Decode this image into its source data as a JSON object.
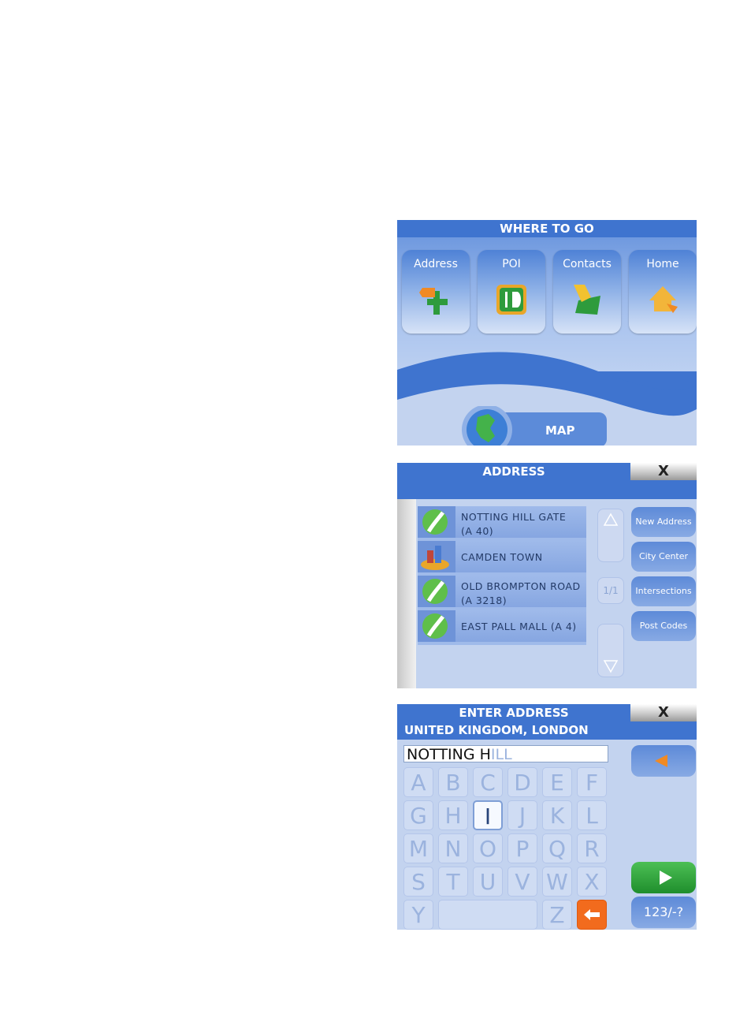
{
  "screen1": {
    "title": "WHERE TO GO",
    "tiles": [
      {
        "label": "Address"
      },
      {
        "label": "POI"
      },
      {
        "label": "Contacts"
      },
      {
        "label": "Home"
      }
    ],
    "map_label": "MAP"
  },
  "screen2": {
    "title": "ADDRESS",
    "close": "X",
    "rows": [
      {
        "line1": "NOTTING HILL GATE",
        "line2": "(A 40)"
      },
      {
        "line1": "CAMDEN TOWN",
        "line2": ""
      },
      {
        "line1": "OLD BROMPTON ROAD",
        "line2": "(A 3218)"
      },
      {
        "line1": "EAST PALL MALL (A 4)",
        "line2": ""
      }
    ],
    "page_indicator": "1/1",
    "side_buttons": [
      "New Address",
      "City Center",
      "Intersections",
      "Post Codes"
    ]
  },
  "screen3": {
    "title": "ENTER ADDRESS",
    "close": "X",
    "subtitle": "UNITED KINGDOM, LONDON",
    "typed_text": "NOTTING H",
    "suggest_text": "ILL",
    "keys_row1": [
      "A",
      "B",
      "C",
      "D",
      "E",
      "F"
    ],
    "keys_row2": [
      "G",
      "H",
      "I",
      "J",
      "K",
      "L"
    ],
    "keys_row3": [
      "M",
      "N",
      "O",
      "P",
      "Q",
      "R"
    ],
    "keys_row4": [
      "S",
      "T",
      "U",
      "V",
      "W",
      "X"
    ],
    "keys_row5": [
      "Y",
      "Z"
    ],
    "mode_button": "123/-?",
    "colors": {
      "accent": "#3f74cf",
      "go": "#2fa33a",
      "backspace": "#f26b1d"
    }
  }
}
